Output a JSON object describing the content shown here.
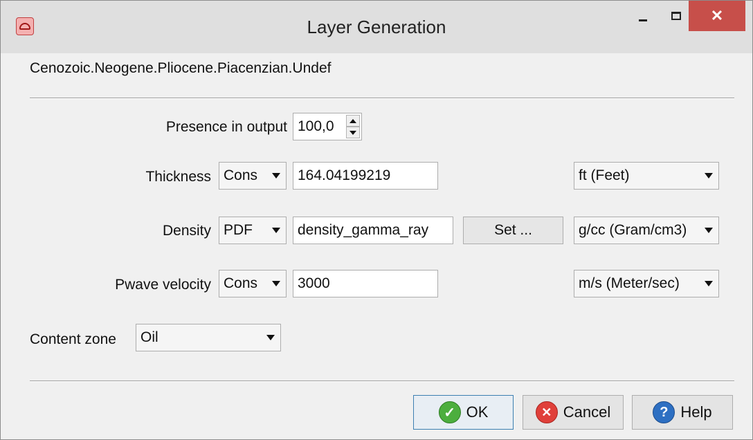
{
  "window": {
    "title": "Layer Generation",
    "minimize_icon": "minimize-icon",
    "maximize_icon": "maximize-icon",
    "close_icon": "close-icon",
    "close_glyph": "✕"
  },
  "path": "Cenozoic.Neogene.Pliocene.Piacenzian.Undef",
  "presence": {
    "label": "Presence in output",
    "value": "100,0"
  },
  "thickness": {
    "label": "Thickness",
    "mode": "Cons",
    "value": "164.04199219",
    "unit": "ft (Feet)"
  },
  "density": {
    "label": "Density",
    "mode": "PDF",
    "value": "density_gamma_ray",
    "set_label": "Set ...",
    "unit": "g/cc (Gram/cm3)"
  },
  "pwave": {
    "label": "Pwave velocity",
    "mode": "Cons",
    "value": "3000",
    "unit": "m/s (Meter/sec)"
  },
  "content_zone": {
    "label": "Content zone",
    "value": "Oil"
  },
  "buttons": {
    "ok": "OK",
    "cancel": "Cancel",
    "help": "Help",
    "ok_glyph": "✓",
    "cancel_glyph": "✕",
    "help_glyph": "?"
  },
  "colors": {
    "close_button": "#c74f4a",
    "ok_icon": "#4cae3e",
    "cancel_icon": "#e0403a",
    "help_icon": "#2d6fc2"
  }
}
